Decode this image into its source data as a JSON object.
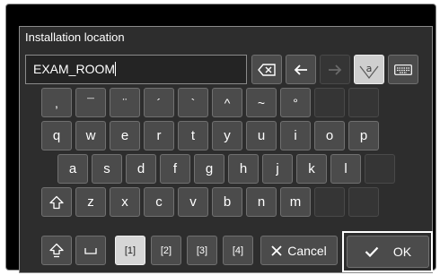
{
  "dialog": {
    "title": "Installation location"
  },
  "input": {
    "value": "EXAM_ROOM"
  },
  "toolbar": {
    "backspace_icon": "backspace-icon",
    "left_icon": "arrow-left-icon",
    "right_icon": "arrow-right-icon",
    "mode_icon": "character-mode-icon",
    "mode_glyph": "a",
    "keyboard_icon": "keyboard-icon"
  },
  "keyboard": {
    "symbols": [
      ",",
      "¯",
      "¨",
      "´",
      "`",
      "^",
      "~",
      "°"
    ],
    "row1": [
      "q",
      "w",
      "e",
      "r",
      "t",
      "y",
      "u",
      "i",
      "o",
      "p"
    ],
    "row2": [
      "a",
      "s",
      "d",
      "f",
      "g",
      "h",
      "j",
      "k",
      "l"
    ],
    "row3": [
      "z",
      "x",
      "c",
      "v",
      "b",
      "n",
      "m"
    ],
    "pages": [
      "[1]",
      "[2]",
      "[3]",
      "[4]"
    ],
    "selected_page": "[1]"
  },
  "actions": {
    "cancel": "Cancel",
    "ok": "OK"
  },
  "icons": {
    "shift": "shift-icon",
    "caps_lock": "caps-lock-icon",
    "space": "space-icon",
    "cancel": "close-icon",
    "ok": "checkmark-icon"
  }
}
